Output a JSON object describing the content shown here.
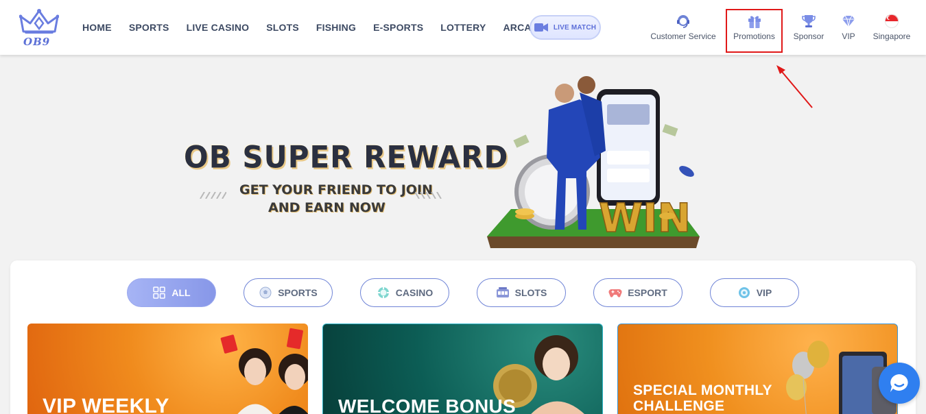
{
  "header": {
    "logo_text": "OB9",
    "nav": [
      "HOME",
      "SPORTS",
      "LIVE CASINO",
      "SLOTS",
      "FISHING",
      "E-SPORTS",
      "LOTTERY",
      "ARCADES"
    ],
    "live_match_label": "LIVE MATCH",
    "utilities": {
      "customer_service": "Customer Service",
      "promotions": "Promotions",
      "sponsor": "Sponsor",
      "vip": "VIP",
      "region": "Singapore"
    }
  },
  "banner": {
    "title": "OB SUPER REWARD",
    "subtitle_line1": "GET YOUR FRIEND TO JOIN",
    "subtitle_line2": "AND EARN NOW",
    "art_text": "WIN"
  },
  "tabs": [
    {
      "label": "ALL",
      "icon": "grid-icon",
      "active": true
    },
    {
      "label": "SPORTS",
      "icon": "soccer-ball-icon",
      "active": false
    },
    {
      "label": "CASINO",
      "icon": "casino-chip-icon",
      "active": false
    },
    {
      "label": "SLOTS",
      "icon": "slot-machine-icon",
      "active": false
    },
    {
      "label": "ESPORT",
      "icon": "gamepad-icon",
      "active": false
    },
    {
      "label": "VIP",
      "icon": "vip-coin-icon",
      "active": false
    }
  ],
  "promo_cards": [
    {
      "title": "VIP WEEKLY"
    },
    {
      "title": "WELCOME BONUS"
    },
    {
      "title_line1": "SPECIAL MONTHLY",
      "title_line2": "CHALLENGE"
    }
  ],
  "colors": {
    "nav_text": "#3d4a63",
    "accent": "#6e83d6",
    "highlight_box": "#e01818",
    "chat_button": "#2f7ff0"
  }
}
